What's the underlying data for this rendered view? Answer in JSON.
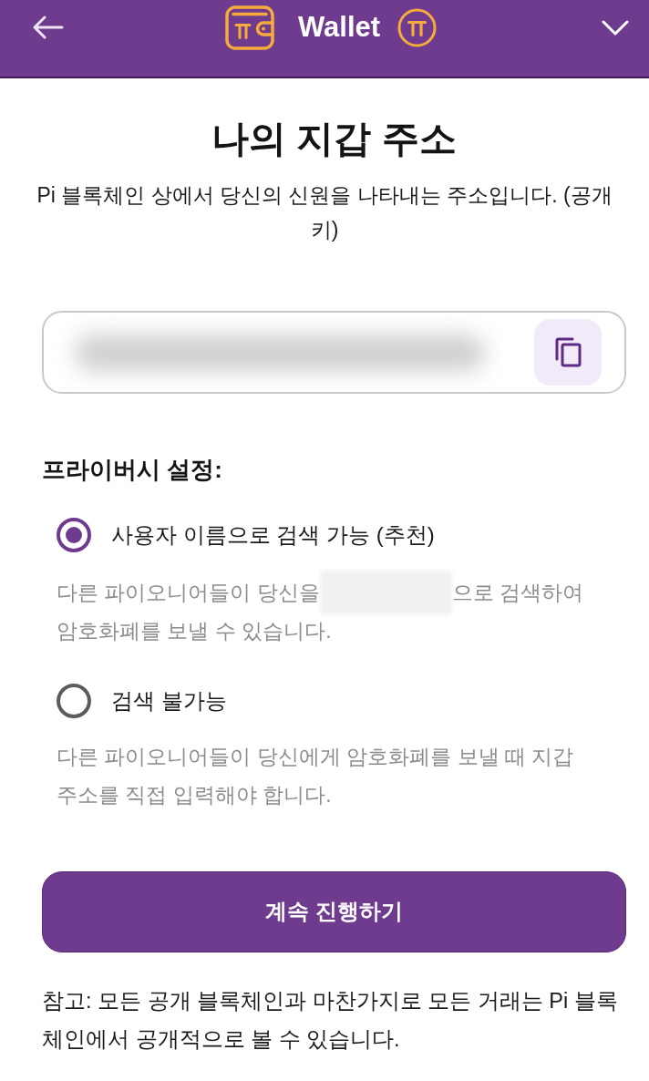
{
  "header": {
    "title": "Wallet"
  },
  "title": "나의 지갑 주소",
  "subtitle": "Pi 블록체인 상에서 당신의 신원을 나타내는 주소입니다. (공개 키)",
  "privacy": {
    "heading": "프라이버시 설정:",
    "options": [
      {
        "label": "사용자 이름으로 검색 가능 (추천)",
        "selected": true,
        "description": [
          [
            {
              "kind": "text",
              "text": "다른 파이오니어들이 당신을"
            },
            {
              "kind": "redacted"
            },
            {
              "kind": "text",
              "text": "으로 검색하여"
            }
          ],
          [
            {
              "kind": "text",
              "text": "암호화폐를 보낼 수 있습니다."
            }
          ]
        ]
      },
      {
        "label": "검색 불가능",
        "selected": false,
        "description": [
          [
            {
              "kind": "text",
              "text": "다른 파이오니어들이 당신에게 암호화폐를 보낼 때 지갑 주소를 직접 입력해야 합니다."
            }
          ]
        ]
      }
    ]
  },
  "continue_button": {
    "label": "계속 진행하기"
  },
  "note": "참고: 모든 공개 블록체인과 마찬가지로 모든 거래는 Pi 블록체인에서 공개적으로 볼 수 있습니다."
}
